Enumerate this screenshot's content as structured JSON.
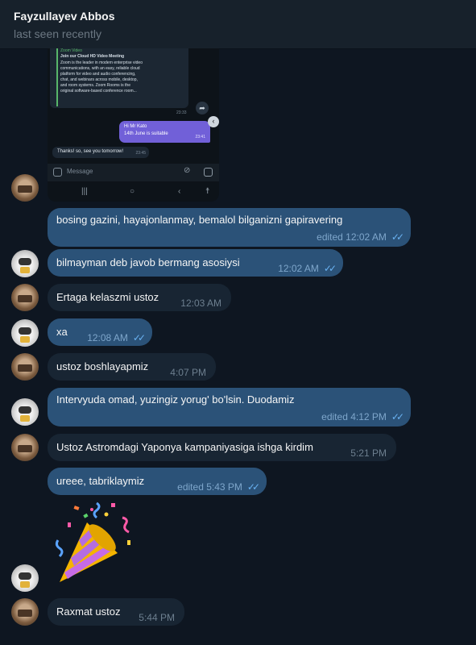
{
  "header": {
    "name": "Fayzullayev Abbos",
    "status": "last seen recently"
  },
  "screenshot": {
    "quote_lines": [
      "Zoom Video",
      "Join our Cloud HD Video Meeting",
      "Zoom is the leader in modern enterprise video",
      "communications, with an easy, reliable cloud",
      "platform for video and audio conferencing,",
      "chat, and webinars across mobile, desktop,",
      "and room systems. Zoom Rooms is the",
      "original software-based conference room..."
    ],
    "quote_time": "23:33",
    "sent_line1": "Hi Mr Kato",
    "sent_line2": "14th June  is suitable",
    "sent_time": "23:41",
    "reply_text": "Thanks! so, see you tomorrow!",
    "reply_time": "23:45",
    "input_placeholder": "Message"
  },
  "messages": [
    {
      "dir": "out",
      "text": "bosing gazini, hayajonlanmay, bemalol bilganizni gapiravering",
      "meta": "edited 12:02 AM"
    },
    {
      "dir": "out",
      "text": "bilmayman deb javob bermang asosiysi",
      "meta": "12:02 AM"
    },
    {
      "dir": "in",
      "text": "Ertaga kelaszmi ustoz",
      "meta": "12:03 AM"
    },
    {
      "dir": "out",
      "text": "xa",
      "meta": "12:08 AM"
    },
    {
      "dir": "in",
      "text": "ustoz boshlayapmiz",
      "meta": "4:07 PM"
    },
    {
      "dir": "out",
      "text": "Intervyuda omad, yuzingiz yorug' bo'lsin. Duodamiz",
      "meta": "edited 4:12 PM"
    },
    {
      "dir": "in",
      "text": "Ustoz Astromdagi Yaponya kampaniyasiga ishga kirdim",
      "meta": "5:21 PM"
    },
    {
      "dir": "out",
      "text": "ureee, tabriklaymiz",
      "meta": "edited 5:43 PM"
    },
    {
      "dir": "in",
      "text": "Raxmat ustoz",
      "meta": "5:44 PM"
    }
  ],
  "colors": {
    "background": "#0e1621",
    "incoming_bubble": "#182533",
    "outgoing_bubble": "#2b5278",
    "read_ticks": "#6ab2f2"
  }
}
